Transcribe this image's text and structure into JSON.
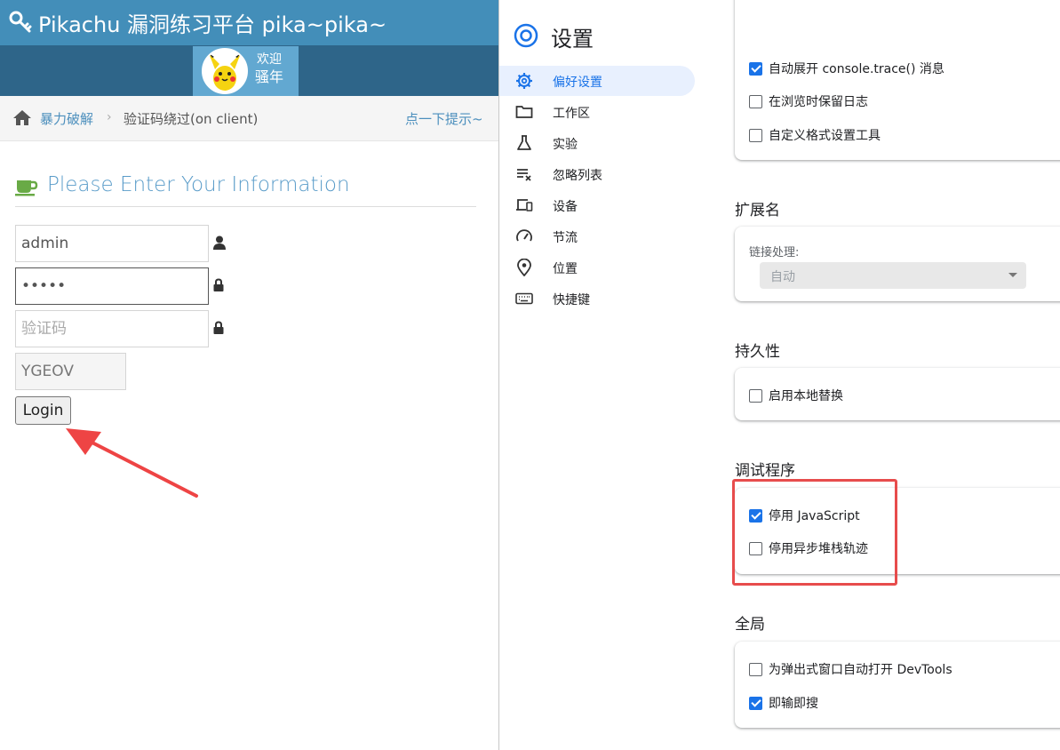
{
  "pikachu": {
    "brand": "Pikachu 漏洞练习平台 pika~pika~",
    "welcome_line1": "欢迎",
    "welcome_line2": "骚年",
    "breadcrumb": {
      "parent": "暴力破解",
      "current": "验证码绕过(on client)",
      "hint": "点一下提示~"
    },
    "form": {
      "title": "Please Enter Your Information",
      "username_value": "admin",
      "password_value": "admin",
      "captcha_placeholder": "验证码",
      "captcha_code": "YGEOV",
      "login_label": "Login"
    },
    "colors": {
      "topbar": "#438eb9",
      "userbar": "#2e6589",
      "accent": "#4c8fbd"
    }
  },
  "devtools": {
    "title": "设置",
    "nav": [
      {
        "label": "偏好设置",
        "icon": "gear-icon",
        "active": true
      },
      {
        "label": "工作区",
        "icon": "folder-icon"
      },
      {
        "label": "实验",
        "icon": "flask-icon"
      },
      {
        "label": "忽略列表",
        "icon": "ignore-list-icon"
      },
      {
        "label": "设备",
        "icon": "devices-icon"
      },
      {
        "label": "节流",
        "icon": "speedometer-icon"
      },
      {
        "label": "位置",
        "icon": "location-pin-icon"
      },
      {
        "label": "快捷键",
        "icon": "keyboard-icon"
      }
    ],
    "top_card": [
      {
        "label": "自动展开 console.trace() 消息",
        "checked": true
      },
      {
        "label": "在浏览时保留日志",
        "checked": false
      },
      {
        "label": "自定义格式设置工具",
        "checked": false
      }
    ],
    "extensions": {
      "title": "扩展名",
      "link_label": "链接处理:",
      "link_value": "自动"
    },
    "persistence": {
      "title": "持久性",
      "items": [
        {
          "label": "启用本地替换",
          "checked": false
        }
      ]
    },
    "debugger": {
      "title": "调试程序",
      "items": [
        {
          "label": "停用 JavaScript",
          "checked": true
        },
        {
          "label": "停用异步堆栈轨迹",
          "checked": false
        }
      ]
    },
    "global": {
      "title": "全局",
      "items": [
        {
          "label": "为弹出式窗口自动打开 DevTools",
          "checked": false
        },
        {
          "label": "即输即搜",
          "checked": true
        }
      ]
    },
    "colors": {
      "accent": "#1a73e8",
      "highlight": "#e74c4c"
    }
  }
}
